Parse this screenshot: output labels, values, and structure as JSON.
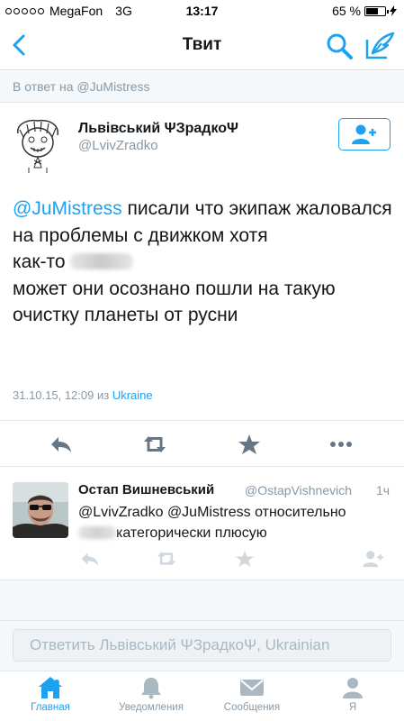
{
  "status": {
    "carrier": "MegaFon",
    "network": "3G",
    "time": "13:17",
    "battery": "65 %",
    "battery_level": 0.65
  },
  "nav": {
    "title": "Твит",
    "icons": [
      "back-chevron-icon",
      "search-icon",
      "compose-icon"
    ]
  },
  "reply_to": "В ответ на @JuMistress",
  "tweet": {
    "author_name": "Львівський ΨЗрадкоΨ",
    "author_handle": "@LvivZradko",
    "mention": "@JuMistress",
    "text_1": " писали что экипаж жаловался на проблемы с движком хотя",
    "text_2": "как-то",
    "text_3": "может они осознано пошли на такую очистку планеты от русни",
    "date": "31.10.15, 12:09 из ",
    "place": "Ukraine",
    "accent": "#1da1f2"
  },
  "reply": {
    "name": "Остап Вишневський",
    "handle": "@OstapVishnevich",
    "time": "1ч",
    "line_1": "@LvivZradko @JuMistress относительно",
    "line_2": "категорически плюсую"
  },
  "composer": {
    "placeholder": "Ответить Львівський ΨЗрадкоΨ, Ukrainian"
  },
  "tabs": [
    {
      "label": "Главная",
      "icon": "home-icon",
      "active": true
    },
    {
      "label": "Уведомления",
      "icon": "bell-icon",
      "active": false
    },
    {
      "label": "Сообщения",
      "icon": "envelope-icon",
      "active": false
    },
    {
      "label": "Я",
      "icon": "person-icon",
      "active": false
    }
  ]
}
